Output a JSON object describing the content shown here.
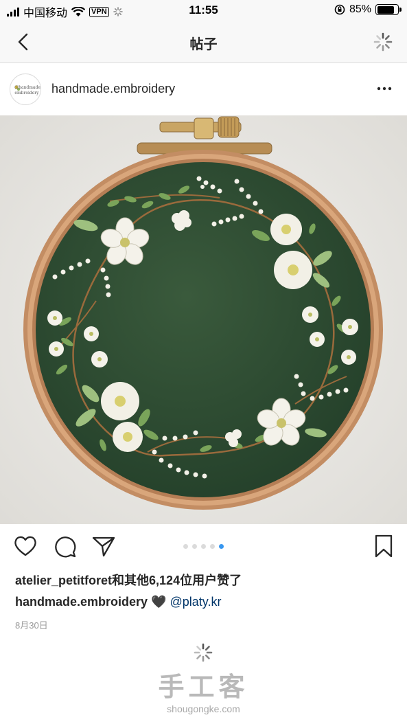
{
  "status": {
    "carrier": "中国移动",
    "vpn": "VPN",
    "time": "11:55",
    "battery": "85%",
    "battery_level": 0.85
  },
  "nav": {
    "title": "帖子",
    "back_icon": "chevron-left-icon",
    "loading_icon": "spinner-icon"
  },
  "post": {
    "username": "handmade.embroidery",
    "avatar_text_1": "@handmade",
    "avatar_text_2": "embroidery",
    "more_icon": "more-icon",
    "photo_description_icon": "embroidery-hoop-photo",
    "carousel": {
      "count": 5,
      "active_index": 4
    },
    "likes_text": "atelier_petitforet和其他6,124位用户赞了",
    "caption_user": "handmade.embroidery",
    "caption_emoji": "🖤",
    "caption_mention": "@platy.kr",
    "date": "8月30日"
  },
  "watermark": {
    "brand": "手工客",
    "url": "shougongke.com"
  },
  "colors": {
    "fabric_green": "#2f4a32",
    "hoop_wood": "#c9926a",
    "link_blue": "#003569",
    "active_dot": "#3897f0"
  }
}
